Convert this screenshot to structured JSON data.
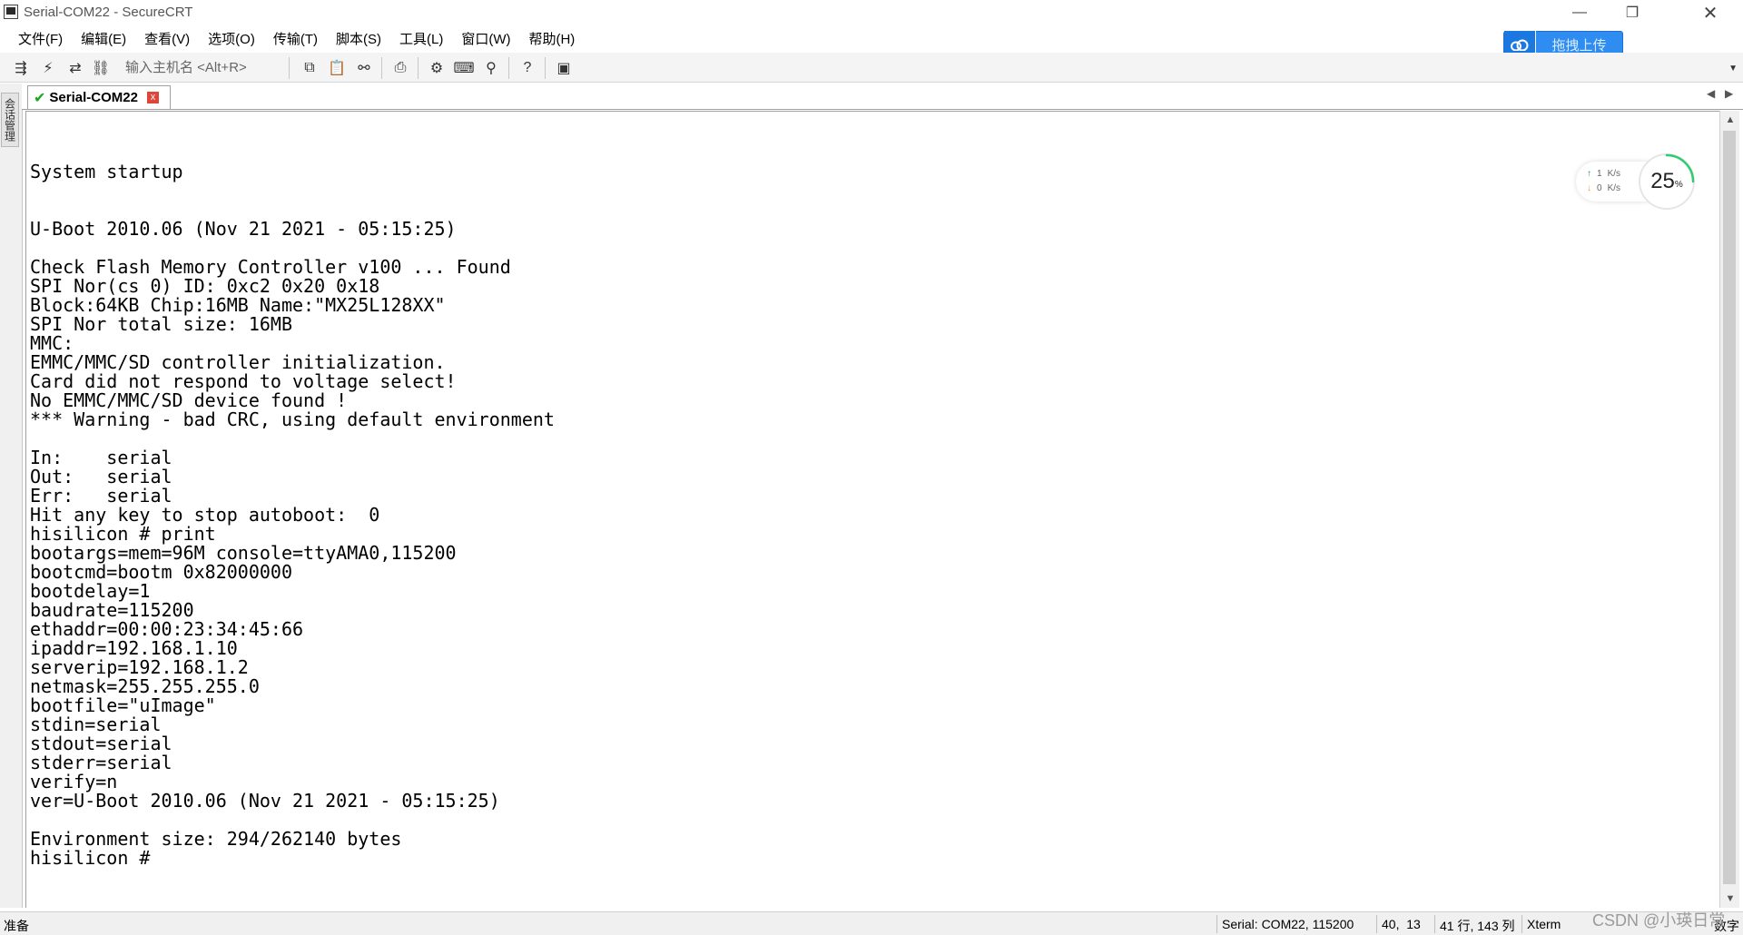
{
  "window": {
    "title": "Serial-COM22 - SecureCRT",
    "minimize": "—",
    "maximize": "❐",
    "close": "✕"
  },
  "menu": [
    "文件(F)",
    "编辑(E)",
    "查看(V)",
    "选项(O)",
    "传输(T)",
    "脚本(S)",
    "工具(L)",
    "窗口(W)",
    "帮助(H)"
  ],
  "upload": {
    "label": "拖拽上传"
  },
  "toolbar": {
    "host_placeholder": "输入主机名 <Alt+R>",
    "icons": [
      "connect-icon",
      "quick-connect-icon",
      "reconnect-icon",
      "disconnect-icon",
      "copy-icon",
      "paste-icon",
      "find-icon",
      "print-icon",
      "settings-icon",
      "keymap-icon",
      "sftp-icon",
      "help-icon",
      "screen-icon"
    ]
  },
  "side_panel": {
    "tab_label": "会话管理"
  },
  "tab": {
    "label": "Serial-COM22",
    "close": "x"
  },
  "terminal": {
    "lines": [
      "System startup",
      "",
      "",
      "U-Boot 2010.06 (Nov 21 2021 - 05:15:25)",
      "",
      "Check Flash Memory Controller v100 ... Found",
      "SPI Nor(cs 0) ID: 0xc2 0x20 0x18",
      "Block:64KB Chip:16MB Name:\"MX25L128XX\"",
      "SPI Nor total size: 16MB",
      "MMC:",
      "EMMC/MMC/SD controller initialization.",
      "Card did not respond to voltage select!",
      "No EMMC/MMC/SD device found !",
      "*** Warning - bad CRC, using default environment",
      "",
      "In:    serial",
      "Out:   serial",
      "Err:   serial",
      "Hit any key to stop autoboot:  0",
      "hisilicon # print",
      "bootargs=mem=96M console=ttyAMA0,115200",
      "bootcmd=bootm 0x82000000",
      "bootdelay=1",
      "baudrate=115200",
      "ethaddr=00:00:23:34:45:66",
      "ipaddr=192.168.1.10",
      "serverip=192.168.1.2",
      "netmask=255.255.255.0",
      "bootfile=\"uImage\"",
      "stdin=serial",
      "stdout=serial",
      "stderr=serial",
      "verify=n",
      "ver=U-Boot 2010.06 (Nov 21 2021 - 05:15:25)",
      "",
      "Environment size: 294/262140 bytes",
      "hisilicon # "
    ]
  },
  "net_widget": {
    "up_rate": "1",
    "down_rate": "0",
    "unit": "K/s",
    "percent": "25",
    "percent_sign": "%",
    "percent_value": 0.25,
    "ring_color": "#2ecc71"
  },
  "status": {
    "ready": "准备",
    "connection": "Serial: COM22, 115200",
    "cursor": "40,  13",
    "size": "41 行, 143 列",
    "terminal_type": "Xterm",
    "num_lock": "数字"
  },
  "watermark": "CSDN @小瑛日常",
  "colors": {
    "upload_blue": "#2f8cf0",
    "tab_check_green": "#1aa81a",
    "tab_close_red": "#e0453a"
  }
}
